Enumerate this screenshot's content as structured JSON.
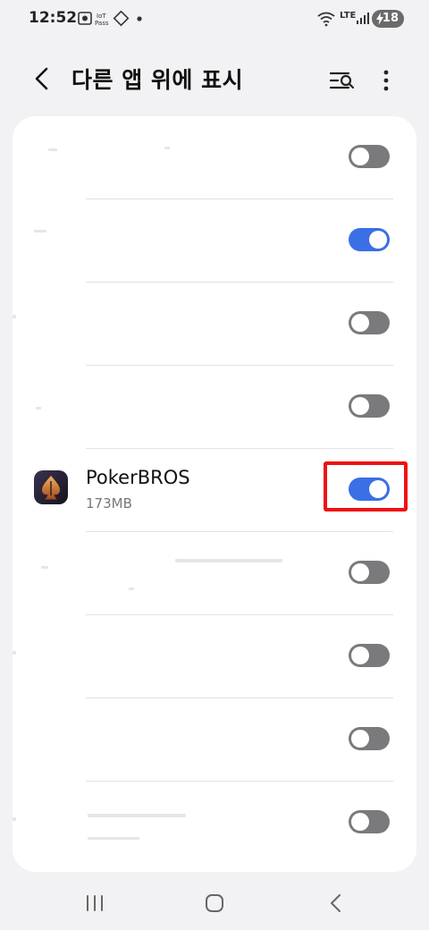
{
  "status_bar": {
    "time": "12:52",
    "battery": "18",
    "network": "LTE"
  },
  "app_bar": {
    "title": "다른 앱 위에 표시"
  },
  "apps": [
    {
      "name": "",
      "size": "",
      "enabled": false
    },
    {
      "name": "",
      "size": "",
      "enabled": true
    },
    {
      "name": "",
      "size": "",
      "enabled": false
    },
    {
      "name": "",
      "size": "",
      "enabled": false
    },
    {
      "name": "PokerBROS",
      "size": "173MB",
      "enabled": true,
      "highlighted": true
    },
    {
      "name": "",
      "size": "",
      "enabled": false
    },
    {
      "name": "",
      "size": "",
      "enabled": false
    },
    {
      "name": "",
      "size": "",
      "enabled": false
    },
    {
      "name": "",
      "size": "",
      "enabled": false
    }
  ],
  "colors": {
    "toggle_on": "#3a6fe5",
    "toggle_off": "#7a7a7c",
    "highlight": "#ee1111",
    "background": "#f2f2f4"
  }
}
